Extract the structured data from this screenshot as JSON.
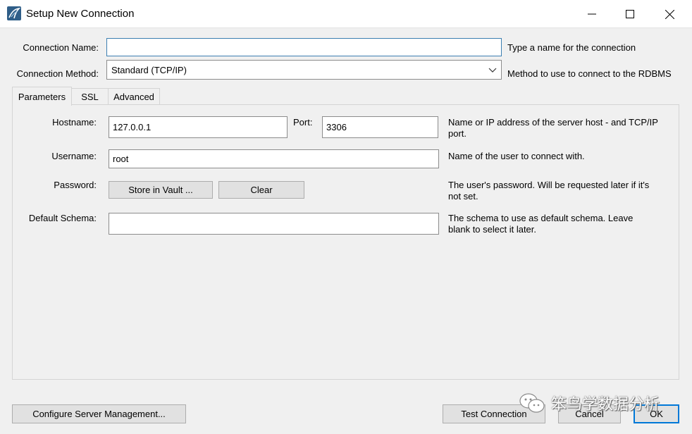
{
  "window": {
    "title": "Setup New Connection"
  },
  "form": {
    "connection_name_label": "Connection Name:",
    "connection_name_value": "",
    "connection_name_help": "Type a name for the connection",
    "connection_method_label": "Connection Method:",
    "connection_method_value": "Standard (TCP/IP)",
    "connection_method_help": "Method to use to connect to the RDBMS"
  },
  "tabs": [
    {
      "label": "Parameters",
      "active": true
    },
    {
      "label": "SSL",
      "active": false
    },
    {
      "label": "Advanced",
      "active": false
    }
  ],
  "parameters": {
    "hostname_label": "Hostname:",
    "hostname_value": "127.0.0.1",
    "port_label": "Port:",
    "port_value": "3306",
    "hostname_help": "Name or IP address of the server host - and TCP/IP port.",
    "username_label": "Username:",
    "username_value": "root",
    "username_help": "Name of the user to connect with.",
    "password_label": "Password:",
    "store_vault_label": "Store in Vault ...",
    "clear_label": "Clear",
    "password_help": "The user's password. Will be requested later if it's not set.",
    "schema_label": "Default Schema:",
    "schema_value": "",
    "schema_help": "The schema to use as default schema. Leave blank to select it later."
  },
  "footer": {
    "configure_label": "Configure Server Management...",
    "test_label": "Test Connection",
    "cancel_label": "Cancel",
    "ok_label": "OK"
  },
  "watermark": {
    "text": "笨鸟学数据分析"
  },
  "colors": {
    "accent": "#0078d7",
    "focus": "#3c7fb1",
    "app_icon": "#2f5e88"
  }
}
